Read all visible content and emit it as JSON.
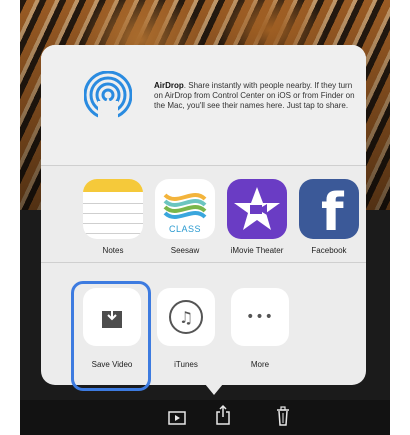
{
  "airdrop": {
    "title": "AirDrop",
    "description": ". Share instantly with people nearby. If they turn on AirDrop from Control Center on iOS or from Finder on the Mac, you'll see their names here. Just tap to share."
  },
  "apps": [
    {
      "label": "Notes",
      "icon": "notes-icon"
    },
    {
      "label": "Seesaw",
      "icon": "seesaw-icon",
      "icon_text": "CLASS"
    },
    {
      "label": "iMovie Theater",
      "icon": "imovie-star-icon"
    },
    {
      "label": "Facebook",
      "icon": "facebook-icon",
      "icon_text": "f"
    }
  ],
  "actions": [
    {
      "label": "Save Video",
      "icon": "save-video-icon"
    },
    {
      "label": "iTunes",
      "icon": "music-note-icon",
      "icon_text": "♫"
    },
    {
      "label": "More",
      "icon": "more-icon",
      "icon_text": "•••"
    }
  ],
  "toolbar": {
    "icons": [
      "play-icon",
      "share-icon",
      "trash-icon"
    ]
  },
  "colors": {
    "highlight": "#3d7be0",
    "airdrop": "#2a8be0",
    "notes": "#f5c93a",
    "imovie": "#6a3cc4",
    "facebook": "#3b5998"
  }
}
